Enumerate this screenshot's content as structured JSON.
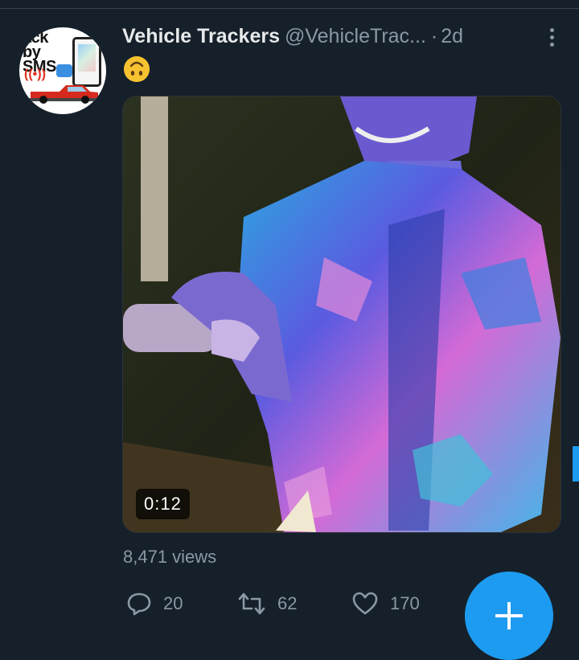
{
  "tweet": {
    "display_name": "Vehicle Trackers",
    "handle": "@VehicleTrac...",
    "separator": "·",
    "time": "2d",
    "emoji": "upside-down-face-emoji",
    "video_duration": "0:12",
    "views": "8,471 views"
  },
  "avatar": {
    "logo_line1": "ack",
    "logo_line2": "by SMS"
  },
  "actions": {
    "reply_count": "20",
    "retweet_count": "62",
    "like_count": "170"
  },
  "icons": {
    "more": "more-vertical-icon",
    "reply": "reply-icon",
    "retweet": "retweet-icon",
    "like": "heart-icon",
    "compose": "plus-icon"
  },
  "colors": {
    "background": "#15202b",
    "accent": "#1d9bf0",
    "muted": "#8b98a5",
    "text": "#e7e9ea"
  }
}
